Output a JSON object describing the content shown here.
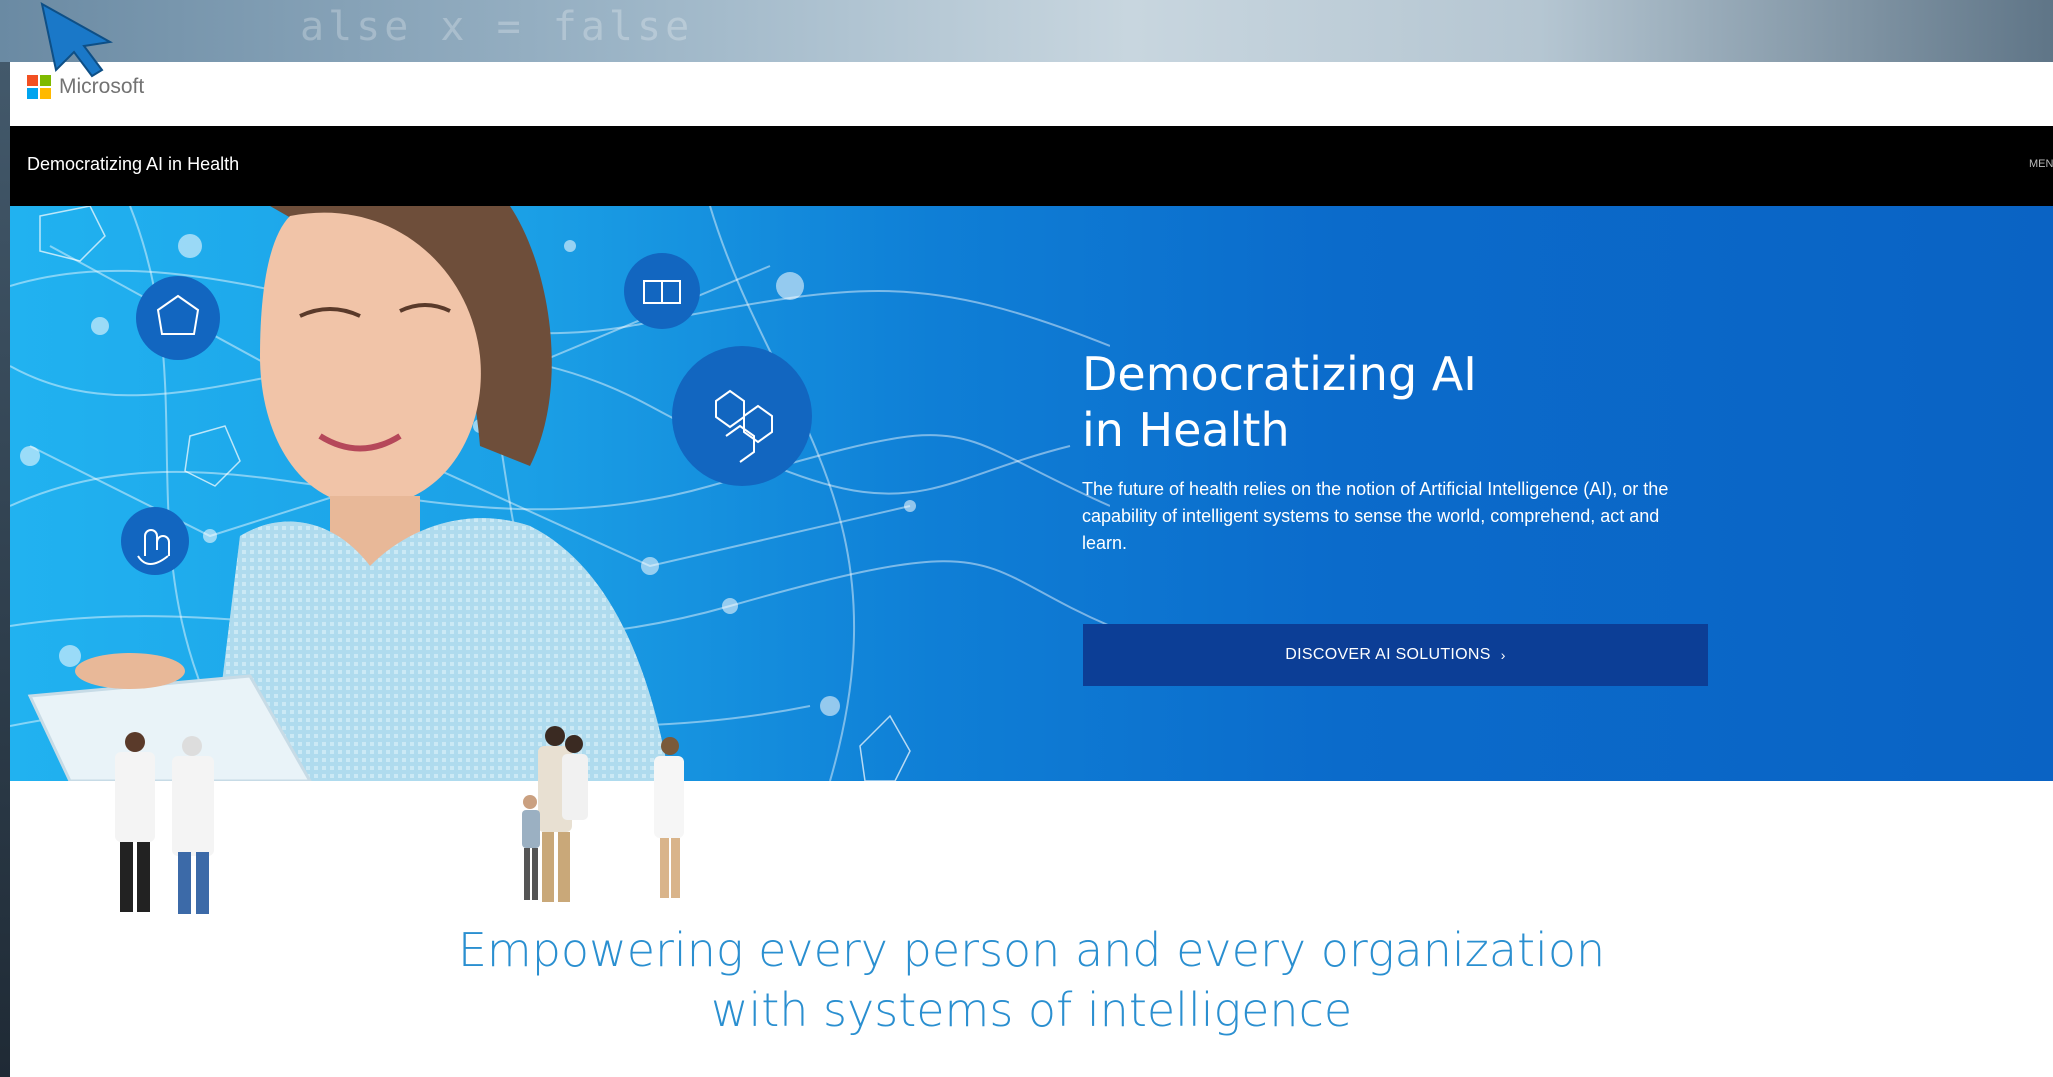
{
  "backdrop": {
    "code_text": "alse x = false"
  },
  "header": {
    "brand_name": "Microsoft"
  },
  "site_bar": {
    "title": "Democratizing AI in Health",
    "menu_label": "MEN"
  },
  "hero": {
    "title_line1": "Democratizing AI",
    "title_line2": "in Health",
    "description": "The future of health relies on the notion of Artificial Intelligence (AI), or the capability of intelligent systems to sense the world, comprehend, act and learn.",
    "cta_label": "DISCOVER AI SOLUTIONS",
    "cta_chevron": "›"
  },
  "tagline": {
    "line1": "Empowering every person and every organization",
    "line2": "with systems of intelligence"
  },
  "colors": {
    "hero_blue": "#0b6bcb",
    "cta_navy": "#0c3e96",
    "tagline_blue": "#2a8fd0",
    "site_bar": "#000000"
  },
  "icons": [
    "microsoft-logo-icon",
    "network-icon",
    "hexagon-molecule-icon",
    "touch-hand-icon",
    "document-icon",
    "mouse-cursor-icon"
  ]
}
